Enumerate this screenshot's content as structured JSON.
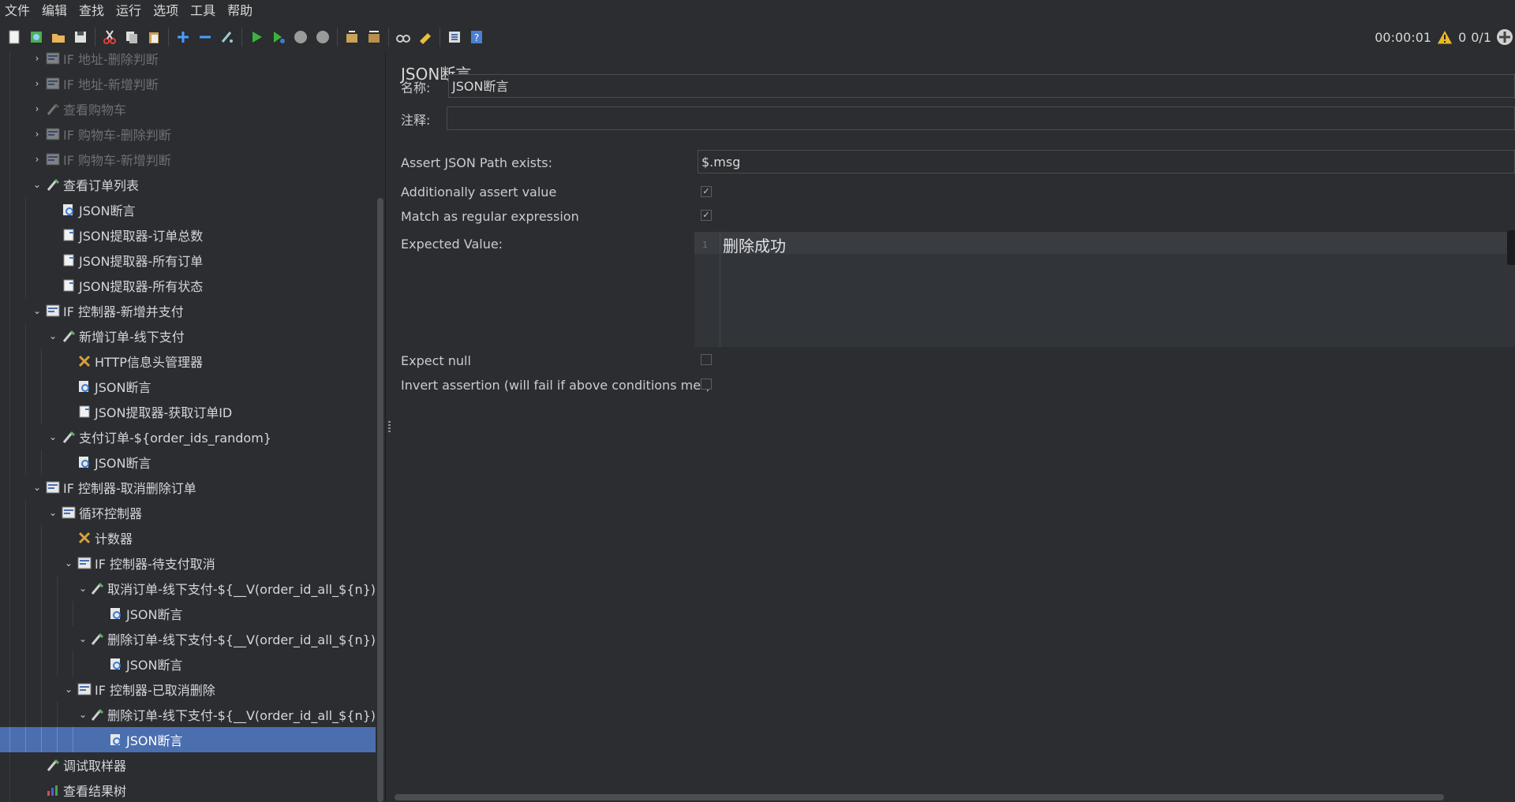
{
  "menu": [
    "文件",
    "编辑",
    "查找",
    "运行",
    "选项",
    "工具",
    "帮助"
  ],
  "toolbar": {
    "icons": [
      "new-icon",
      "templates-icon",
      "open-icon",
      "save-icon",
      "cut-icon",
      "copy-icon",
      "paste-icon",
      "expand-icon",
      "collapse-icon",
      "toggle-icon",
      "start-icon",
      "start-no-pause-icon",
      "stop-icon",
      "shutdown-icon",
      "clear-icon",
      "clear-all-icon",
      "search-icon",
      "reset-search-icon",
      "function-helper-icon",
      "help-icon"
    ],
    "elapsed": "00:00:01",
    "warning_count": "0",
    "threads": "0/1"
  },
  "tree": [
    {
      "label": "IF 地址-删除判断",
      "depth": 1,
      "arrow": "›",
      "icon": "if-controller",
      "disabled": true
    },
    {
      "label": "IF 地址-新增判断",
      "depth": 1,
      "arrow": "›",
      "icon": "if-controller",
      "disabled": true
    },
    {
      "label": "查看购物车",
      "depth": 1,
      "arrow": "›",
      "icon": "sampler",
      "disabled": true
    },
    {
      "label": "IF 购物车-删除判断",
      "depth": 1,
      "arrow": "›",
      "icon": "if-controller",
      "disabled": true
    },
    {
      "label": "IF 购物车-新增判断",
      "depth": 1,
      "arrow": "›",
      "icon": "if-controller",
      "disabled": true
    },
    {
      "label": "查看订单列表",
      "depth": 1,
      "arrow": "⌄",
      "icon": "sampler",
      "disabled": false
    },
    {
      "label": "JSON断言",
      "depth": 2,
      "arrow": "",
      "icon": "assertion",
      "disabled": false
    },
    {
      "label": "JSON提取器-订单总数",
      "depth": 2,
      "arrow": "",
      "icon": "extractor",
      "disabled": false
    },
    {
      "label": "JSON提取器-所有订单",
      "depth": 2,
      "arrow": "",
      "icon": "extractor",
      "disabled": false
    },
    {
      "label": "JSON提取器-所有状态",
      "depth": 2,
      "arrow": "",
      "icon": "extractor",
      "disabled": false
    },
    {
      "label": "IF 控制器-新增并支付",
      "depth": 1,
      "arrow": "⌄",
      "icon": "if-controller",
      "disabled": false
    },
    {
      "label": "新增订单-线下支付",
      "depth": 2,
      "arrow": "⌄",
      "icon": "sampler",
      "disabled": false
    },
    {
      "label": "HTTP信息头管理器",
      "depth": 3,
      "arrow": "",
      "icon": "config",
      "disabled": false
    },
    {
      "label": "JSON断言",
      "depth": 3,
      "arrow": "",
      "icon": "assertion",
      "disabled": false
    },
    {
      "label": "JSON提取器-获取订单ID",
      "depth": 3,
      "arrow": "",
      "icon": "extractor",
      "disabled": false
    },
    {
      "label": "支付订单-${order_ids_random}",
      "depth": 2,
      "arrow": "⌄",
      "icon": "sampler",
      "disabled": false
    },
    {
      "label": "JSON断言",
      "depth": 3,
      "arrow": "",
      "icon": "assertion",
      "disabled": false
    },
    {
      "label": "IF 控制器-取消删除订单",
      "depth": 1,
      "arrow": "⌄",
      "icon": "if-controller",
      "disabled": false
    },
    {
      "label": "循环控制器",
      "depth": 2,
      "arrow": "⌄",
      "icon": "if-controller",
      "disabled": false
    },
    {
      "label": "计数器",
      "depth": 3,
      "arrow": "",
      "icon": "config",
      "disabled": false
    },
    {
      "label": "IF 控制器-待支付取消",
      "depth": 3,
      "arrow": "⌄",
      "icon": "if-controller",
      "disabled": false
    },
    {
      "label": "取消订单-线下支付-${__V(order_id_all_${n})}",
      "depth": 4,
      "arrow": "⌄",
      "icon": "sampler",
      "disabled": false
    },
    {
      "label": "JSON断言",
      "depth": 5,
      "arrow": "",
      "icon": "assertion",
      "disabled": false
    },
    {
      "label": "删除订单-线下支付-${__V(order_id_all_${n})}",
      "depth": 4,
      "arrow": "⌄",
      "icon": "sampler",
      "disabled": false
    },
    {
      "label": "JSON断言",
      "depth": 5,
      "arrow": "",
      "icon": "assertion",
      "disabled": false
    },
    {
      "label": "IF 控制器-已取消删除",
      "depth": 3,
      "arrow": "⌄",
      "icon": "if-controller",
      "disabled": false
    },
    {
      "label": "删除订单-线下支付-${__V(order_id_all_${n})}",
      "depth": 4,
      "arrow": "⌄",
      "icon": "sampler",
      "disabled": false
    },
    {
      "label": "JSON断言",
      "depth": 5,
      "arrow": "",
      "icon": "assertion",
      "disabled": false,
      "selected": true
    },
    {
      "label": "调试取样器",
      "depth": 1,
      "arrow": "",
      "icon": "sampler",
      "disabled": false
    },
    {
      "label": "查看结果树",
      "depth": 1,
      "arrow": "",
      "icon": "listener",
      "disabled": false
    }
  ],
  "panel": {
    "title": "JSON断言",
    "name_label": "名称:",
    "name_value": "JSON断言",
    "comment_label": "注释:",
    "comment_value": "",
    "path_label": "Assert JSON Path exists:",
    "path_value": "$.msg",
    "assert_value_label": "Additionally assert value",
    "assert_value_checked": true,
    "regex_label": "Match as regular expression",
    "regex_checked": true,
    "expected_label": "Expected Value:",
    "expected_line_number": "1",
    "expected_value": "删除成功",
    "expect_null_label": "Expect null",
    "expect_null_checked": false,
    "invert_label": "Invert assertion (will fail if above conditions met)",
    "invert_checked": false
  },
  "colors": {
    "background": "#2b2d30",
    "selection": "#4b6eaf",
    "text": "#c9ccd1",
    "disabled_text": "#6d7075",
    "warning": "#e8b923"
  }
}
